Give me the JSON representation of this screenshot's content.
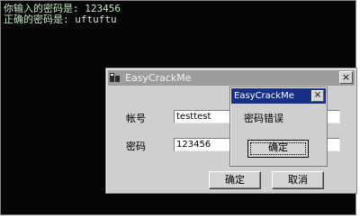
{
  "console": {
    "line1": "你输入的密码是: 123456",
    "line2": "正确的密码是: uftuftu"
  },
  "main_window": {
    "title": "EasyCrackMe",
    "icon": "app-icon",
    "close_label": "×",
    "account_label": "帐号",
    "account_value": "testtest",
    "password_label": "密码",
    "password_value": "123456",
    "ok_label": "确定",
    "cancel_label": "取消"
  },
  "message_box": {
    "title": "EasyCrackMe",
    "close_label": "×",
    "message": "密码错误",
    "ok_label": "确定",
    "title_color": "#182f88"
  }
}
